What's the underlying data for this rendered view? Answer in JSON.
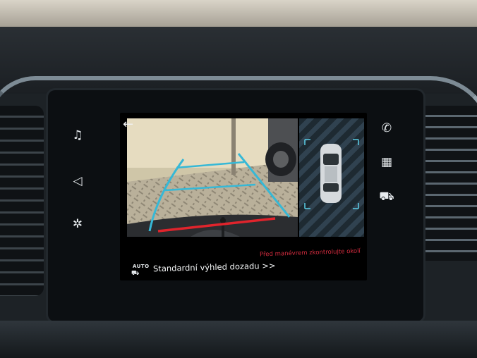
{
  "screen": {
    "left_menu": [
      {
        "icon": "music-note-icon",
        "glyph": "♫"
      },
      {
        "icon": "navigation-icon",
        "glyph": "◁"
      },
      {
        "icon": "fan-icon",
        "glyph": "✲"
      }
    ],
    "right_menu": [
      {
        "icon": "phone-icon",
        "glyph": "✆"
      },
      {
        "icon": "apps-grid-icon",
        "glyph": "▦"
      },
      {
        "icon": "car-icon",
        "glyph": "⛟"
      }
    ],
    "back_glyph": "←",
    "view_mode": {
      "auto_label": "AUTO",
      "view_label": "Standardní výhled dozadu >>"
    },
    "warning": "Před manévrem zkontrolujte okolí",
    "guide_colors": {
      "trajectory": "#36b8d6",
      "stop_line": "#e0242c"
    }
  }
}
